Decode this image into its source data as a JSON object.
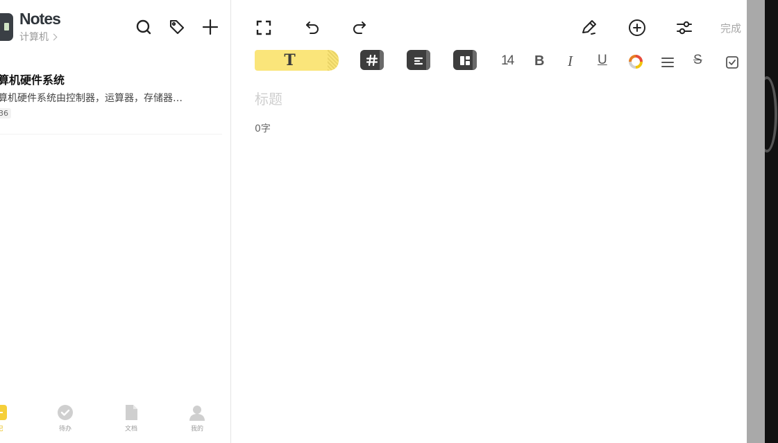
{
  "app": {
    "title": "Notes",
    "folder": "计算机"
  },
  "header_icons": [
    "search-icon",
    "tag-icon",
    "plus-icon"
  ],
  "notes": [
    {
      "title": "算机硬件系统",
      "snippet": "算机硬件系统由控制器，运算器，存储器…",
      "badge": "36"
    }
  ],
  "bottom_nav": [
    {
      "label": "记",
      "icon": "note-icon",
      "active": true
    },
    {
      "label": "待办",
      "icon": "check-circle-icon",
      "active": false
    },
    {
      "label": "文档",
      "icon": "document-icon",
      "active": false
    },
    {
      "label": "我的",
      "icon": "person-icon",
      "active": false
    }
  ],
  "editor": {
    "toolbar": {
      "done_label": "完成",
      "icons": [
        "fullscreen-icon",
        "undo-icon",
        "redo-icon",
        "pen-icon",
        "add-circle-icon",
        "adjust-icon"
      ]
    },
    "format_bar": {
      "text_style_label": "T",
      "font_size": "14",
      "bold_label": "B",
      "italic_label": "I",
      "underline_label": "U",
      "strike_label": "S"
    },
    "title_placeholder": "标题",
    "word_count": "0字"
  },
  "colors": {
    "accent_yellow": "#fae57a",
    "dark_button": "#3d3d3d",
    "active_nav": "#e6b800"
  }
}
